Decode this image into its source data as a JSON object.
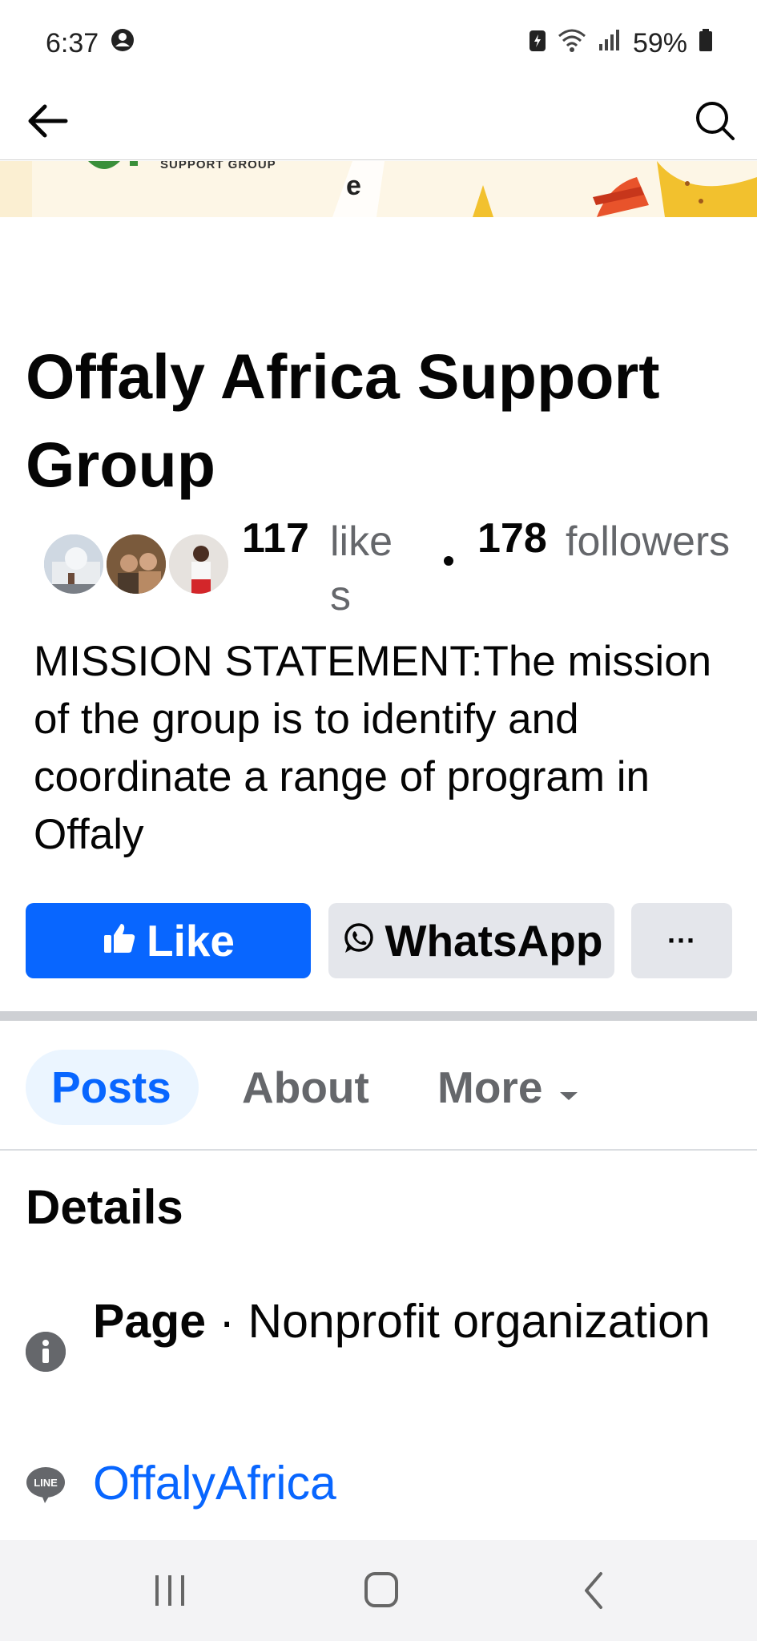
{
  "status_bar": {
    "time": "6:37",
    "battery_percent": "59%",
    "icons": [
      "account-circle-icon",
      "battery-saver-icon",
      "wifi-icon",
      "signal-icon",
      "battery-icon"
    ]
  },
  "nav": {
    "back_icon": "arrow-left-icon",
    "search_icon": "search-icon"
  },
  "cover": {
    "small_text": "SUPPORT GROUP",
    "fragment_text": "e"
  },
  "page": {
    "title": "Offaly Africa Support Group",
    "likes_count": "117",
    "likes_label": "likes",
    "followers_count": "178",
    "followers_label": "followers",
    "mission": "MISSION STATEMENT:The mission of the group is to identify and coordinate a range of program in Offaly"
  },
  "actions": {
    "like_label": "Like",
    "whatsapp_label": "WhatsApp",
    "more_label": "···"
  },
  "tabs": {
    "posts": "Posts",
    "about": "About",
    "more": "More",
    "active": "Posts"
  },
  "details": {
    "heading": "Details",
    "category_bold": "Page",
    "category_sep": " · ",
    "category_value": "Nonprofit organization",
    "line_icon_label": "LINE",
    "line_account": "OffalyAfrica"
  },
  "colors": {
    "accent": "#0866ff",
    "secondary_button": "#e4e6eb",
    "muted_text": "#65676b",
    "tab_active_bg": "#ebf5ff"
  }
}
